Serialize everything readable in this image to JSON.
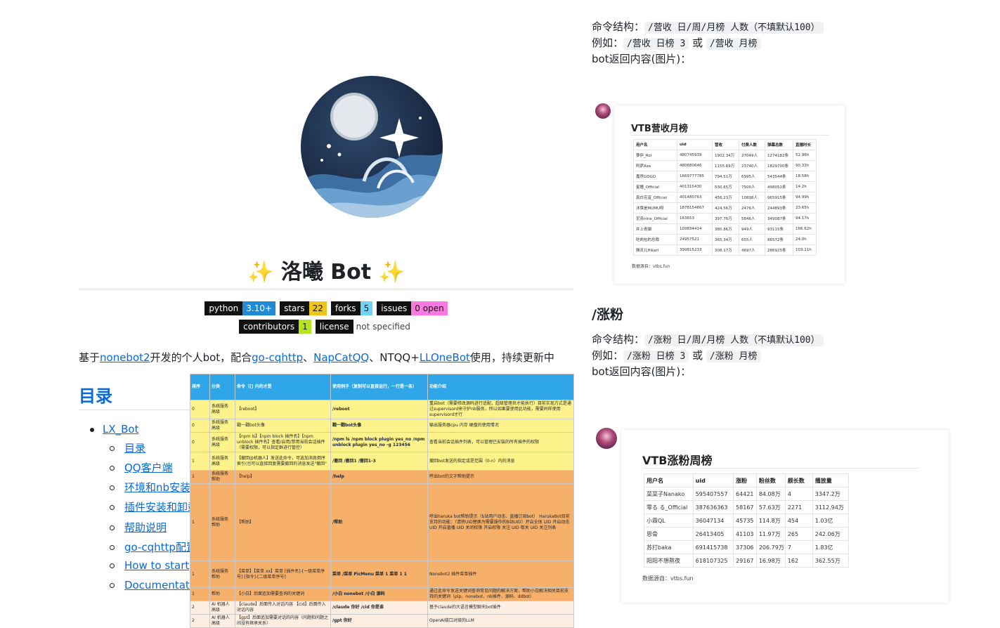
{
  "readme": {
    "title": "洛曦 Bot",
    "sparkle": "✨",
    "badges_row1": [
      {
        "key": "python",
        "value": "3.10+",
        "color": "#1f8ad8",
        "text": "#ffffff"
      },
      {
        "key": "stars",
        "value": "22",
        "color": "#f0c419",
        "text": "#111111"
      },
      {
        "key": "forks",
        "value": "5",
        "color": "#6cd4f5",
        "text": "#111111"
      },
      {
        "key": "issues",
        "value": "0 open",
        "color": "#ff77e0",
        "text": "#111111"
      }
    ],
    "badges_row2": [
      {
        "key": "contributors",
        "value": "1",
        "color": "#b5e61d",
        "text": "#111111"
      },
      {
        "key": "license",
        "value": "not specified",
        "color": "",
        "text": "#444444"
      }
    ],
    "intro": {
      "p1": "基于",
      "l1": "nonebot2",
      "p2": "开发的个人bot，配合",
      "l2": "go-cqhttp",
      "p3": "、",
      "l3": "NapCatQQ",
      "p4": "、NTQQ+",
      "l4": "LLOneBot",
      "p5": "使用，持续更新中"
    },
    "toc_heading": "目录",
    "toc": [
      {
        "label": "LX_Bot",
        "level": 1
      },
      {
        "label": "目录",
        "level": 2
      },
      {
        "label": "QQ客户端",
        "level": 2
      },
      {
        "label": "环境和nb安装",
        "level": 2
      },
      {
        "label": "插件安装和卸载",
        "level": 2
      },
      {
        "label": "帮助说明",
        "level": 2
      },
      {
        "label": "go-cqhttp配置",
        "level": 2
      },
      {
        "label": "How to start",
        "level": 2
      },
      {
        "label": "Documentation",
        "level": 2
      }
    ]
  },
  "command_table": {
    "headers": [
      "排序",
      "分类",
      "命令（[] 内的才是",
      "使用例子（复制可以直接运行，一行是一条）",
      "功能介绍"
    ],
    "rows": [
      {
        "c": [
          "0",
          "系统服务 高级",
          "【reboot】",
          "/reboot",
          "重启bot（需要修改源码进行适配，超级管理员才能执行）目前实现方式是通过supervisord来守护nb服务，所以如果要使用此功能，需要同样使用supervisord才行"
        ],
        "cls": "y"
      },
      {
        "c": [
          "0",
          "系统服务 高级",
          "戳一戳bot头像",
          "戳一戳bot头像",
          "输出服务器cpu 内存 硬盘的使用情况"
        ],
        "cls": "y"
      },
      {
        "c": [
          "0",
          "系统服务 高级",
          "【npm ls】【npm block 插件名】【npm unblock 插件名】查看/启用/禁用当前会话插件（需要权限，可以指定群进行管控）",
          "/npm ls /npm block plugin yes_no /npm unblock plugin yes_no -g 123456",
          "查看当前会话插件列表，可以管理已安装的所有插件的权限"
        ],
        "cls": "y"
      },
      {
        "c": [
          "1",
          "系统服务 高级",
          "【撤回@机器人】发送此命令，可选加消息倒序索引(也可以直接回复需要撤回的消息发送\"撤回\"",
          "/撤回 /撤回1 /撤回1-3",
          "撤回bot发送的指定或是范围（0-n）内的消息"
        ],
        "cls": "y"
      },
      {
        "c": [
          "1",
          "系统服务 帮助",
          "【help】",
          "/help",
          "呼出bot的文字帮助提示"
        ],
        "cls": "o"
      },
      {
        "c": [
          "1",
          "系统服务 帮助",
          "【帮助】",
          "/帮助",
          "呼出haruka bot帮助提示（b站用户动态、直播订阅bot） HarukaBot目前支持的功能：（请将UID替换为需要操作的B站UID）开启全体 UID 开启动态 UID 开启直播 UID 关闭权限 开启权限 关注 UID 取关 UID 关注列表"
        ],
        "cls": "o"
      },
      {
        "c": [
          "1",
          "系统服务 帮助",
          "【菜单】【菜单 xx】菜单 [插件名]-[一级菜单序号] [指令]-[二级菜单序号]",
          "菜单 /菜单 PicMenu 菜单 1 菜单 1 1",
          "Nonebot2 插件菜单插件"
        ],
        "cls": "o"
      },
      {
        "c": [
          "1",
          "帮助",
          "【小白】后面追加需要查询的关键词",
          "/小白 nonebot /小白 源码",
          "通过此命令发送关键词查询常见问题的解决方案，帮助小白解决相关目前支持的关键词（pip、nonebot、nb插件、源码、ddbot）"
        ],
        "cls": "o"
      },
      {
        "c": [
          "2",
          "AI 机器人 高级",
          "【claude】后面传入对话内容 【cid】后面传入对话内容",
          "/claude 你好 /cid 你是谁",
          "基于claude的大语言模型聊天bot插件"
        ],
        "cls": "w"
      },
      {
        "c": [
          "2",
          "AI 机器人 高级",
          "【gpt】后面追加需要对话的内容（问题和问题之间没有继承关系）",
          "/gpt 你好",
          "OpenAI接口对接的LLM"
        ],
        "cls": "w"
      }
    ]
  },
  "revenue_section": {
    "line1_label": "命令结构：",
    "line1_code": "/营收 日/周/月榜 人数（不填默认100）",
    "line2_label": "例如：",
    "line2_code1": "/营收 日榜 3",
    "line2_or": "或",
    "line2_code2": "/营收 月榜",
    "line3": "bot返回内容(图片)：",
    "card": {
      "title": "VTB营收月榜",
      "headers": [
        "用户名",
        "uid",
        "营收",
        "付费人数",
        "弹幕总数",
        "直播时长"
      ],
      "rows": [
        [
          "萝伊_Roi",
          "480745939",
          "1902.34万",
          "27049人",
          "1274182条",
          "52.96h"
        ],
        [
          "阿萨Aza",
          "480680646",
          "1155.69万",
          "23740人",
          "1829700条",
          "90.33h"
        ],
        [
          "嘉然GOGO",
          "1669777785",
          "794.51万",
          "6995人",
          "543544条",
          "18.58h"
        ],
        [
          "星瞳_Official",
          "401315430",
          "530.65万",
          "7500人",
          "498051条",
          "14.2h"
        ],
        [
          "真白花音_Official",
          "401480763",
          "456.23万",
          "10898人",
          "965915条",
          "94.99h"
        ],
        [
          "沐霂是MUMU呀",
          "1878154667",
          "424.56万",
          "2476人",
          "244893条",
          "23.65h"
        ],
        [
          "尼奈nine_Official",
          "163653",
          "397.76万",
          "5846人",
          "349087条",
          "94.17h"
        ],
        [
          "井上青御",
          "109834414",
          "380.86万",
          "949人",
          "93115条",
          "166.62h"
        ],
        [
          "吃肉包的总裁",
          "24957521",
          "365.34万",
          "655人",
          "86572条",
          "24.0h"
        ],
        [
          "雅灵儿Hikari",
          "399815233",
          "308.17万",
          "4697人",
          "286925条",
          "103.11h"
        ]
      ],
      "source": "数据源自：vtbs.fun"
    }
  },
  "fans_section": {
    "heading": "/涨粉",
    "line1_label": "命令结构：",
    "line1_code": "/涨粉 日/周/月榜 人数（不填默认100）",
    "line2_label": "例如：",
    "line2_code1": "/涨粉 日榜 3",
    "line2_or": "或",
    "line2_code2": "/涨粉 月榜",
    "line3": "bot返回内容(图片)：",
    "card": {
      "title": "VTB涨粉周榜",
      "headers": [
        "用户名",
        "uid",
        "涨粉",
        "粉丝数",
        "舰长数",
        "播放量"
      ],
      "rows": [
        [
          "菜菜子Nanako",
          "595407557",
          "64421",
          "84.08万",
          "4",
          "3347.2万"
        ],
        [
          "零る る_Official",
          "387636363",
          "58167",
          "57.63万",
          "2271",
          "3112.94万"
        ],
        [
          "小霖QL",
          "36047134",
          "45735",
          "114.8万",
          "454",
          "1.03亿"
        ],
        [
          "恩骨",
          "26413405",
          "41103",
          "11.97万",
          "265",
          "242.06万"
        ],
        [
          "苏打baka",
          "691415738",
          "37306",
          "206.79万",
          "7",
          "1.83亿"
        ],
        [
          "阳阳不想熬夜",
          "618107325",
          "29167",
          "16.98万",
          "162",
          "362.55万"
        ]
      ],
      "source": "数据源自：vtbs.fun"
    }
  }
}
